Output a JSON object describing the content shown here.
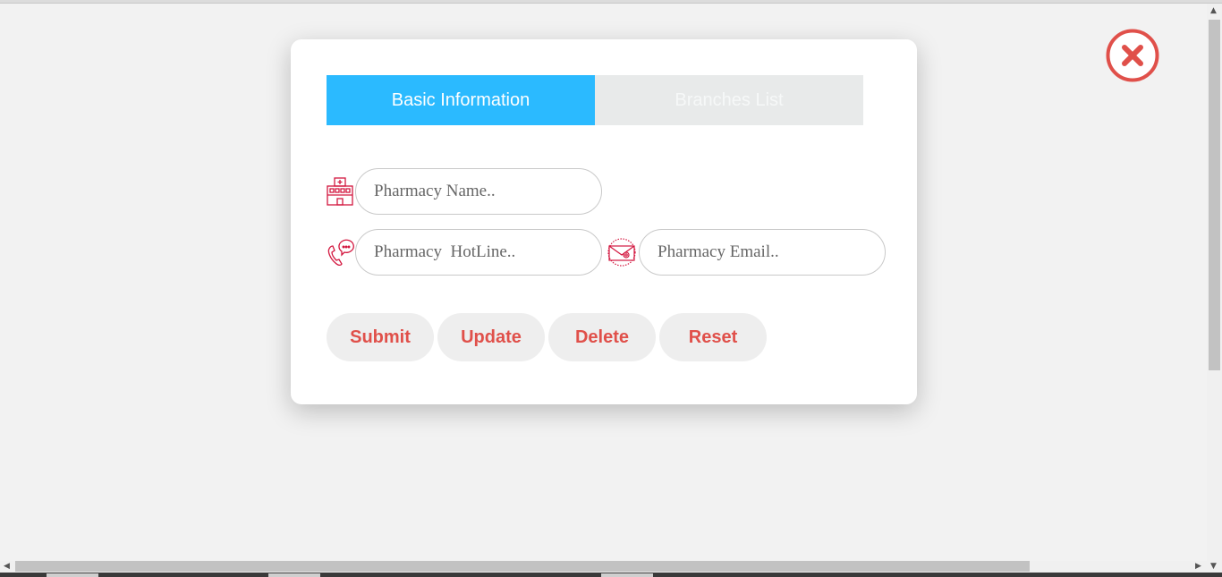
{
  "tabs": [
    {
      "label": "Basic Information",
      "active": true
    },
    {
      "label": "Branches List",
      "active": false
    }
  ],
  "form": {
    "name": {
      "placeholder": "Pharmacy Name..",
      "value": "",
      "icon": "hospital-icon"
    },
    "hotline": {
      "placeholder": "Pharmacy  HotLine..",
      "value": "",
      "icon": "phone-icon"
    },
    "email": {
      "placeholder": "Pharmacy Email..",
      "value": "",
      "icon": "email-icon"
    }
  },
  "buttons": {
    "submit": "Submit",
    "update": "Update",
    "delete": "Delete",
    "reset": "Reset"
  },
  "close": {
    "icon": "close-icon"
  },
  "colors": {
    "accent": "#2bbaff",
    "button_text": "#e0504a",
    "icon": "#d3173f",
    "close": "#e0504a"
  }
}
